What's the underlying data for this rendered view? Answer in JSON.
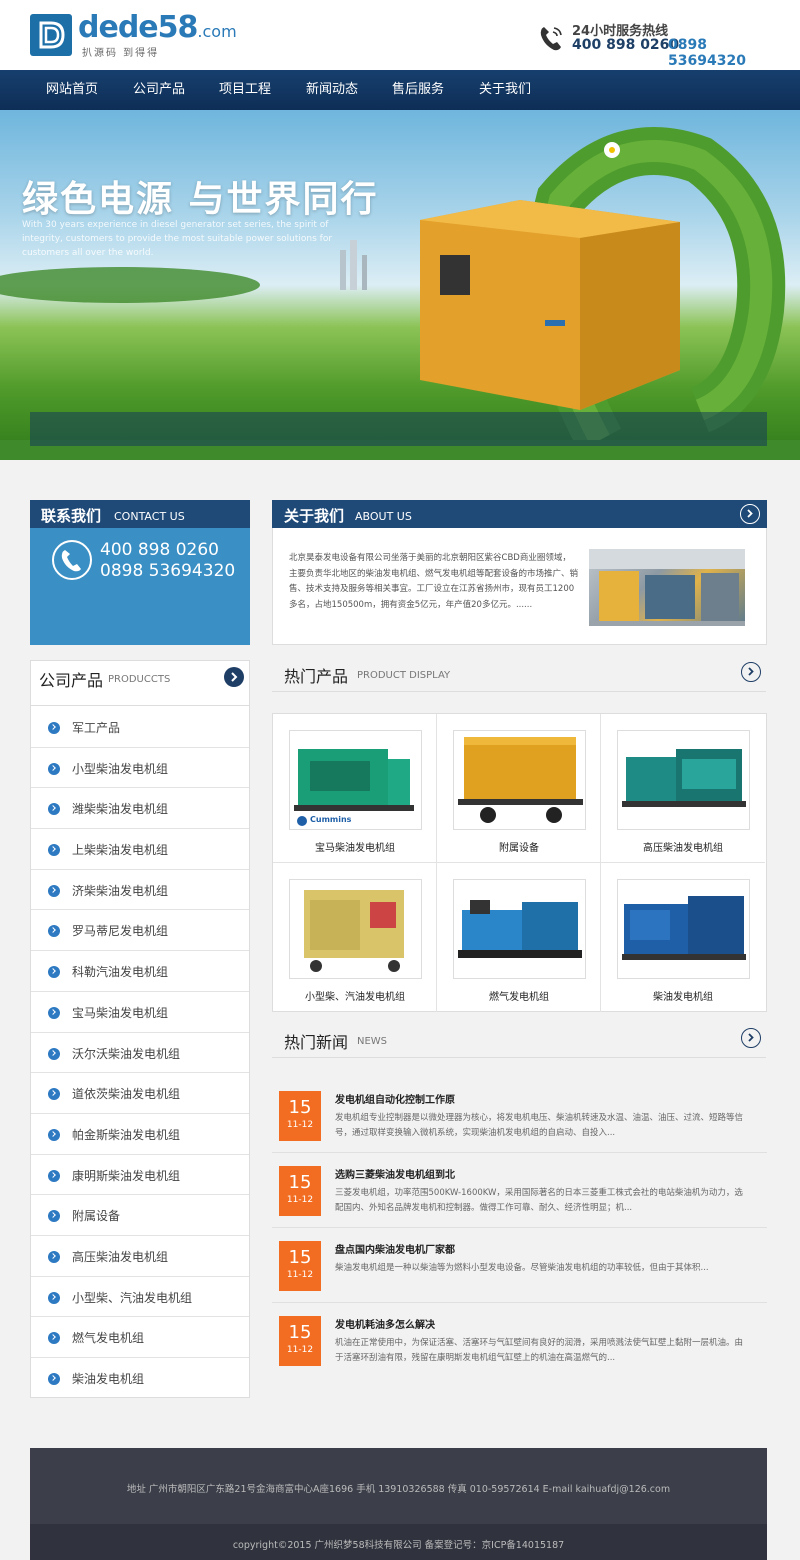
{
  "header": {
    "logo_text": "dede58",
    "logo_domain": ".com",
    "logo_slogan": "扒源码 到得得",
    "hotline_title": "24小时服务热线",
    "hotline_phone1": "400 898 0260",
    "hotline_phone2": "0898 53694320"
  },
  "nav": {
    "items": [
      "网站首页",
      "公司产品",
      "项目工程",
      "新闻动态",
      "售后服务",
      "关于我们"
    ]
  },
  "banner": {
    "title": "绿色电源 与世界同行",
    "subtitle": "With 30 years experience in diesel generator set series, the spirit of integrity, customers to provide the most suitable power solutions for customers all over the world."
  },
  "contact": {
    "title_cn": "联系我们",
    "title_en": "CONTACT US",
    "phone1": "400 898 0260",
    "phone2": "0898 53694320"
  },
  "products_sidebar": {
    "title_cn": "公司产品",
    "title_en": "PRODUCCTS",
    "items": [
      "军工产品",
      "小型柴油发电机组",
      "潍柴柴油发电机组",
      "上柴柴油发电机组",
      "济柴柴油发电机组",
      "罗马蒂尼发电机组",
      "科勒汽油发电机组",
      "宝马柴油发电机组",
      "沃尔沃柴油发电机组",
      "道依茨柴油发电机组",
      "帕金斯柴油发电机组",
      "康明斯柴油发电机组",
      "附属设备",
      "高压柴油发电机组",
      "小型柴、汽油发电机组",
      "燃气发电机组",
      "柴油发电机组"
    ]
  },
  "about": {
    "title_cn": "关于我们",
    "title_en": "ABOUT US",
    "text": "北京昊泰发电设备有限公司坐落于美丽的北京朝阳区紫谷CBD商业圈领域，主要负责华北地区的柴油发电机组、燃气发电机组等配套设备的市场推广、销售、技术支持及服务等相关事宜。工厂设立在江苏省扬州市，现有员工1200多名，占地150500m，拥有资金5亿元，年产值20多亿元。......"
  },
  "hot_products": {
    "title_cn": "热门产品",
    "title_en": "PRODUCT DISPLAY",
    "items": [
      {
        "label": "宝马柴油发电机组",
        "brand": "Cummins",
        "color": "#1a9e78"
      },
      {
        "label": "附属设备",
        "color": "#e0a020"
      },
      {
        "label": "高压柴油发电机组",
        "color": "#1e8c84"
      },
      {
        "label": "小型柴、汽油发电机组",
        "color": "#d9c46a"
      },
      {
        "label": "燃气发电机组",
        "color": "#2a86c8"
      },
      {
        "label": "柴油发电机组",
        "color": "#1e5fa8"
      }
    ]
  },
  "news": {
    "title_cn": "热门新闻",
    "title_en": "NEWS",
    "items": [
      {
        "day": "15",
        "md": "11-12",
        "title": "发电机组自动化控制工作原",
        "desc": "发电机组专业控制器是以微处理器为核心，将发电机电压、柴油机转速及水温、油温、油压、过流、短路等信号，通过取样变换输入微机系统，实现柴油机发电机组的自启动、自投入..."
      },
      {
        "day": "15",
        "md": "11-12",
        "title": "选购三菱柴油发电机组到北",
        "desc": "三菱发电机组，功率范围500KW-1600KW，采用国际著名的日本三菱重工株式会社的电站柴油机为动力，选配国内、外知名品牌发电机和控制器。做得工作可靠、耐久、经济性明显；机..."
      },
      {
        "day": "15",
        "md": "11-12",
        "title": "盘点国内柴油发电机厂家都",
        "desc": "柴油发电机组是一种以柴油等为燃料小型发电设备。尽管柴油发电机组的功率较低，但由于其体积..."
      },
      {
        "day": "15",
        "md": "11-12",
        "title": "发电机耗油多怎么解决",
        "desc": "机油在正常使用中，为保证活塞、活塞环与气缸壁间有良好的润滑，采用喷溅法使气缸壁上黏附一层机油。由于活塞环刮油有限，残留在康明斯发电机组气缸壁上的机油在高温燃气的..."
      }
    ]
  },
  "footer": {
    "info": "地址  广州市朝阳区广东路21号金海商富中心A座1696  手机  13910326588  传真  010-59572614  E-mail  kaihuafdj@126.com",
    "copyright": "copyright©2015  广州织梦58科技有限公司  备案登记号：京ICP备14015187"
  },
  "colors": {
    "nav": "#173f6e",
    "accent_blue": "#3a8fc4",
    "date_orange": "#f26d21",
    "footer": "#3c3f4a"
  }
}
